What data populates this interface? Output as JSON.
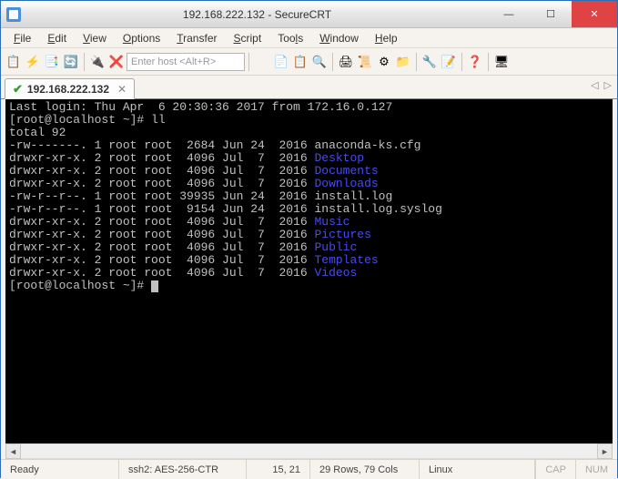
{
  "window": {
    "title": "192.168.222.132 - SecureCRT"
  },
  "menu": {
    "file": "File",
    "edit": "Edit",
    "view": "View",
    "options": "Options",
    "transfer": "Transfer",
    "script": "Script",
    "tools": "Tools",
    "window": "Window",
    "help": "Help"
  },
  "toolbar": {
    "host_placeholder": "Enter host <Alt+R>"
  },
  "tabs": {
    "active": {
      "label": "192.168.222.132"
    }
  },
  "terminal": {
    "last_login": "Last login: Thu Apr  6 20:30:36 2017 from 172.16.0.127",
    "prompt1": "[root@localhost ~]# ",
    "cmd1": "ll",
    "total": "total 92",
    "rows": [
      {
        "perm": "-rw-------.",
        "n": "1",
        "own": "root root",
        "size": " 2684",
        "date": "Jun 24  2016",
        "name": "anaconda-ks.cfg",
        "dir": false
      },
      {
        "perm": "drwxr-xr-x.",
        "n": "2",
        "own": "root root",
        "size": " 4096",
        "date": "Jul  7  2016",
        "name": "Desktop",
        "dir": true
      },
      {
        "perm": "drwxr-xr-x.",
        "n": "2",
        "own": "root root",
        "size": " 4096",
        "date": "Jul  7  2016",
        "name": "Documents",
        "dir": true
      },
      {
        "perm": "drwxr-xr-x.",
        "n": "2",
        "own": "root root",
        "size": " 4096",
        "date": "Jul  7  2016",
        "name": "Downloads",
        "dir": true
      },
      {
        "perm": "-rw-r--r--.",
        "n": "1",
        "own": "root root",
        "size": "39935",
        "date": "Jun 24  2016",
        "name": "install.log",
        "dir": false
      },
      {
        "perm": "-rw-r--r--.",
        "n": "1",
        "own": "root root",
        "size": " 9154",
        "date": "Jun 24  2016",
        "name": "install.log.syslog",
        "dir": false
      },
      {
        "perm": "drwxr-xr-x.",
        "n": "2",
        "own": "root root",
        "size": " 4096",
        "date": "Jul  7  2016",
        "name": "Music",
        "dir": true
      },
      {
        "perm": "drwxr-xr-x.",
        "n": "2",
        "own": "root root",
        "size": " 4096",
        "date": "Jul  7  2016",
        "name": "Pictures",
        "dir": true
      },
      {
        "perm": "drwxr-xr-x.",
        "n": "2",
        "own": "root root",
        "size": " 4096",
        "date": "Jul  7  2016",
        "name": "Public",
        "dir": true
      },
      {
        "perm": "drwxr-xr-x.",
        "n": "2",
        "own": "root root",
        "size": " 4096",
        "date": "Jul  7  2016",
        "name": "Templates",
        "dir": true
      },
      {
        "perm": "drwxr-xr-x.",
        "n": "2",
        "own": "root root",
        "size": " 4096",
        "date": "Jul  7  2016",
        "name": "Videos",
        "dir": true
      }
    ],
    "prompt2": "[root@localhost ~]# "
  },
  "status": {
    "ready": "Ready",
    "cipher": "ssh2: AES-256-CTR",
    "cursor": "15,  21",
    "dims": "29 Rows, 79 Cols",
    "os": "Linux",
    "cap": "CAP",
    "num": "NUM"
  }
}
